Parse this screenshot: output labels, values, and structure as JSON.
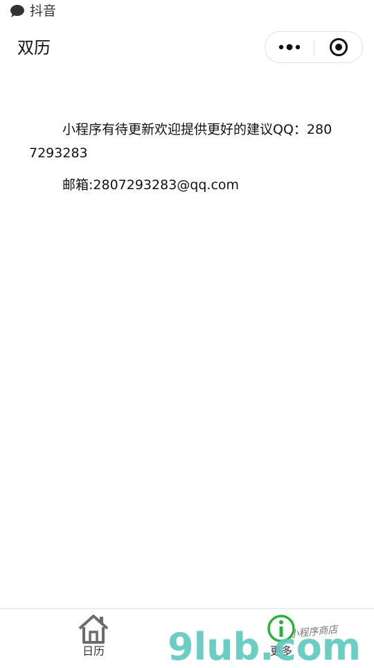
{
  "status_bar": {
    "source_label": "抖音",
    "icon": "chat-bubble-icon"
  },
  "nav": {
    "title": "双历",
    "more_icon": "more-dots-icon",
    "close_icon": "target-close-icon"
  },
  "content": {
    "paragraph_1": "小程序有待更新欢迎提供更好的建议QQ：2807293283",
    "paragraph_2": "邮箱:2807293283@qq.com"
  },
  "tab_bar": {
    "items": [
      {
        "label": "日历",
        "icon": "home-icon"
      },
      {
        "label": "更多",
        "icon": "info-icon"
      }
    ]
  },
  "watermark": {
    "brand": "9lub.com",
    "tagline": "小程序商店",
    "colors": {
      "primary": "#5bc8bd",
      "accent": "#f2a24a",
      "green": "#27b33b"
    }
  }
}
